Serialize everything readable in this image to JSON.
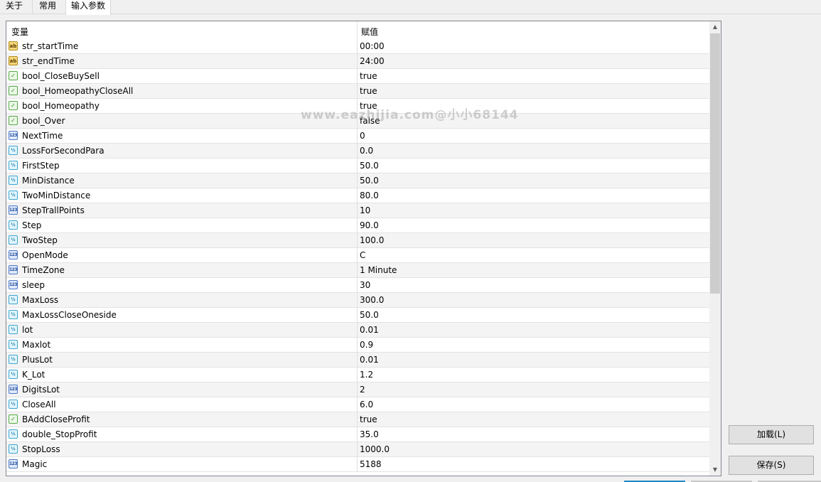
{
  "tabs": [
    {
      "label": "关于"
    },
    {
      "label": "常用"
    },
    {
      "label": "输入参数"
    }
  ],
  "table": {
    "col_variable": "变量",
    "col_value": "赋值",
    "rows": [
      {
        "name": "str_startTime",
        "value": "00:00",
        "type": "string",
        "icon": "string-type-icon",
        "icon_text": "ab"
      },
      {
        "name": "str_endTime",
        "value": "24:00",
        "type": "string",
        "icon": "string-type-icon",
        "icon_text": "ab"
      },
      {
        "name": "bool_CloseBuySell",
        "value": "true",
        "type": "bool",
        "icon": "bool-type-icon",
        "icon_text": "✓"
      },
      {
        "name": "bool_HomeopathyCloseAll",
        "value": "true",
        "type": "bool",
        "icon": "bool-type-icon",
        "icon_text": "✓"
      },
      {
        "name": "bool_Homeopathy",
        "value": "true",
        "type": "bool",
        "icon": "bool-type-icon",
        "icon_text": "✓"
      },
      {
        "name": "bool_Over",
        "value": "false",
        "type": "bool",
        "icon": "bool-type-icon",
        "icon_text": "✓"
      },
      {
        "name": "NextTime",
        "value": "0",
        "type": "int",
        "icon": "integer-type-icon",
        "icon_text": "123"
      },
      {
        "name": "LossForSecondPara",
        "value": "0.0",
        "type": "double",
        "icon": "double-type-icon",
        "icon_text": "½"
      },
      {
        "name": "FirstStep",
        "value": "50.0",
        "type": "double",
        "icon": "double-type-icon",
        "icon_text": "½"
      },
      {
        "name": "MinDistance",
        "value": "50.0",
        "type": "double",
        "icon": "double-type-icon",
        "icon_text": "½"
      },
      {
        "name": "TwoMinDistance",
        "value": "80.0",
        "type": "double",
        "icon": "double-type-icon",
        "icon_text": "½"
      },
      {
        "name": "StepTrallPoints",
        "value": "10",
        "type": "int",
        "icon": "integer-type-icon",
        "icon_text": "123"
      },
      {
        "name": "Step",
        "value": "90.0",
        "type": "double",
        "icon": "double-type-icon",
        "icon_text": "½"
      },
      {
        "name": "TwoStep",
        "value": "100.0",
        "type": "double",
        "icon": "double-type-icon",
        "icon_text": "½"
      },
      {
        "name": "OpenMode",
        "value": "C",
        "type": "int",
        "icon": "integer-type-icon",
        "icon_text": "123"
      },
      {
        "name": "TimeZone",
        "value": "1 Minute",
        "type": "int",
        "icon": "integer-type-icon",
        "icon_text": "123"
      },
      {
        "name": "sleep",
        "value": "30",
        "type": "int",
        "icon": "integer-type-icon",
        "icon_text": "123"
      },
      {
        "name": "MaxLoss",
        "value": "300.0",
        "type": "double",
        "icon": "double-type-icon",
        "icon_text": "½"
      },
      {
        "name": "MaxLossCloseOneside",
        "value": "50.0",
        "type": "double",
        "icon": "double-type-icon",
        "icon_text": "½"
      },
      {
        "name": "lot",
        "value": "0.01",
        "type": "double",
        "icon": "double-type-icon",
        "icon_text": "½"
      },
      {
        "name": "Maxlot",
        "value": "0.9",
        "type": "double",
        "icon": "double-type-icon",
        "icon_text": "½"
      },
      {
        "name": "PlusLot",
        "value": "0.01",
        "type": "double",
        "icon": "double-type-icon",
        "icon_text": "½"
      },
      {
        "name": "K_Lot",
        "value": "1.2",
        "type": "double",
        "icon": "double-type-icon",
        "icon_text": "½"
      },
      {
        "name": "DigitsLot",
        "value": "2",
        "type": "int",
        "icon": "integer-type-icon",
        "icon_text": "123"
      },
      {
        "name": "CloseAll",
        "value": "6.0",
        "type": "double",
        "icon": "double-type-icon",
        "icon_text": "½"
      },
      {
        "name": "BAddCloseProfit",
        "value": "true",
        "type": "bool",
        "icon": "bool-type-icon",
        "icon_text": "✓"
      },
      {
        "name": "double_StopProfit",
        "value": "35.0",
        "type": "double",
        "icon": "double-type-icon",
        "icon_text": "½"
      },
      {
        "name": "StopLoss",
        "value": "1000.0",
        "type": "double",
        "icon": "double-type-icon",
        "icon_text": "½"
      },
      {
        "name": "Magic",
        "value": "5188",
        "type": "int",
        "icon": "integer-type-icon",
        "icon_text": "123"
      }
    ]
  },
  "watermark": "www.eazhijia.com@小小68144",
  "buttons": {
    "load": "加载(L)",
    "save": "保存(S)"
  },
  "colors": {
    "accent": "#1e88c8",
    "border": "#828790",
    "row_alt": "#f4f4f4"
  }
}
